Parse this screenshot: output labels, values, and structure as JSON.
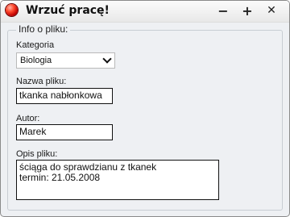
{
  "window": {
    "title": "Wrzuć pracę!",
    "icon": "red-ball-icon",
    "controls": {
      "minimize": "−",
      "maximize": "+",
      "close": "✕"
    }
  },
  "group": {
    "legend": "Info o pliku:"
  },
  "form": {
    "category_label": "Kategoria",
    "category_value": "Biologia",
    "filename_label": "Nazwa pliku:",
    "filename_value": "tkanka nabłonkowa",
    "author_label": "Autor:",
    "author_value": "Marek",
    "description_label": "Opis pliku:",
    "description_lines": [
      "ściąga do sprawdzianu z tkanek",
      "termin: 21.05.2008"
    ]
  }
}
